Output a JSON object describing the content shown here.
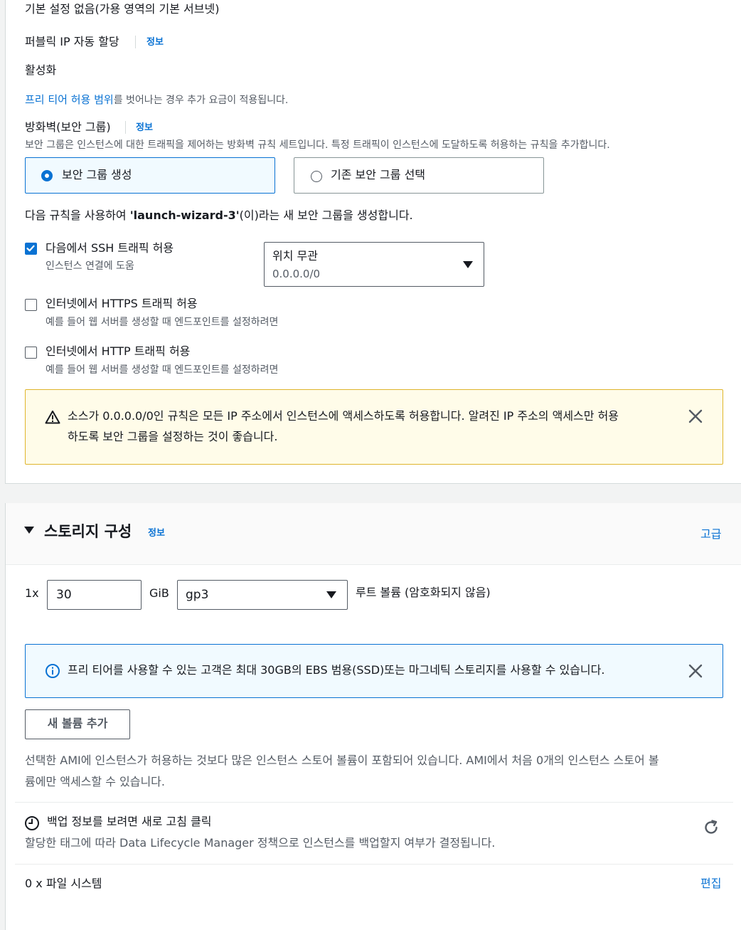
{
  "network": {
    "subnet_value": "기본 설정 없음(가용 영역의 기본 서브넷)",
    "public_ip_label": "퍼블릭 IP 자동 할당",
    "public_ip_info": "정보",
    "public_ip_value": "활성화",
    "free_tier_link": "프리 티어 허용 범위",
    "free_tier_suffix": "를 벗어나는 경우 추가 요금이 적용됩니다.",
    "firewall_label": "방화벽(보안 그룹)",
    "firewall_info": "정보",
    "firewall_desc": "보안 그룹은 인스턴스에 대한 트래픽을 제어하는 방화벽 규칙 세트입니다. 특정 트래픽이 인스턴스에 도달하도록 허용하는 규칙을 추가합니다.",
    "option_create": "보안 그룹 생성",
    "option_existing": "기존 보안 그룹 선택",
    "rule_intro_prefix": "다음 규칙을 사용하여 ",
    "rule_intro_name": "'launch-wizard-3'",
    "rule_intro_suffix": "(이)라는 새 보안 그룹을 생성합니다.",
    "ssh_label": "다음에서 SSH 트래픽 허용",
    "ssh_desc": "인스턴스 연결에 도움",
    "ssh_source_title": "위치 무관",
    "ssh_source_value": "0.0.0.0/0",
    "https_label": "인터넷에서 HTTPS 트래픽 허용",
    "https_desc": "예를 들어 웹 서버를 생성할 때 엔드포인트를 설정하려면",
    "http_label": "인터넷에서 HTTP 트래픽 허용",
    "http_desc": "예를 들어 웹 서버를 생성할 때 엔드포인트를 설정하려면",
    "warning_line1": "소스가 0.0.0.0/0인 규칙은 모든 IP 주소에서 인스턴스에 액세스하도록 허용합니다. 알려진 IP 주소의 액세스만 허용",
    "warning_line2": "하도록 보안 그룹을 설정하는 것이 좋습니다.",
    "ssh_checked": true,
    "https_checked": false,
    "http_checked": false
  },
  "storage": {
    "title": "스토리지 구성",
    "info": "정보",
    "advanced": "고급",
    "multiplier": "1x",
    "size_value": "30",
    "unit": "GiB",
    "volume_type": "gp3",
    "root_label": "루트 볼륨  (암호화되지 않음)",
    "info_alert": "프리 티어를 사용할 수 있는 고객은 최대 30GB의 EBS 범용(SSD)또는 마그네틱 스토리지를 사용할 수 있습니다.",
    "add_volume": "새 볼륨 추가",
    "ami_note_line1": "선택한 AMI에 인스턴스가 허용하는 것보다 많은 인스턴스 스토어 볼륨이 포함되어 있습니다. AMI에서 처음 0개의 인스턴스 스토어 볼",
    "ami_note_line2": "륨에만 액세스할 수 있습니다.",
    "backup_title": "백업 정보를 보려면 새로 고침 클릭",
    "backup_desc": "할당한 태그에 따라 Data Lifecycle Manager 정책으로 인스턴스를 백업할지 여부가 결정됩니다.",
    "filesystems": "0 x 파일 시스템",
    "edit": "편집"
  },
  "colors": {
    "link": "#0972d3",
    "warning_bg": "#fffce9",
    "warning_border": "#dfb52c",
    "info_bg": "#f1faff"
  },
  "icons": [
    "warning-icon",
    "close-icon",
    "info-icon",
    "clock-icon",
    "refresh-icon",
    "caret-down-icon"
  ]
}
